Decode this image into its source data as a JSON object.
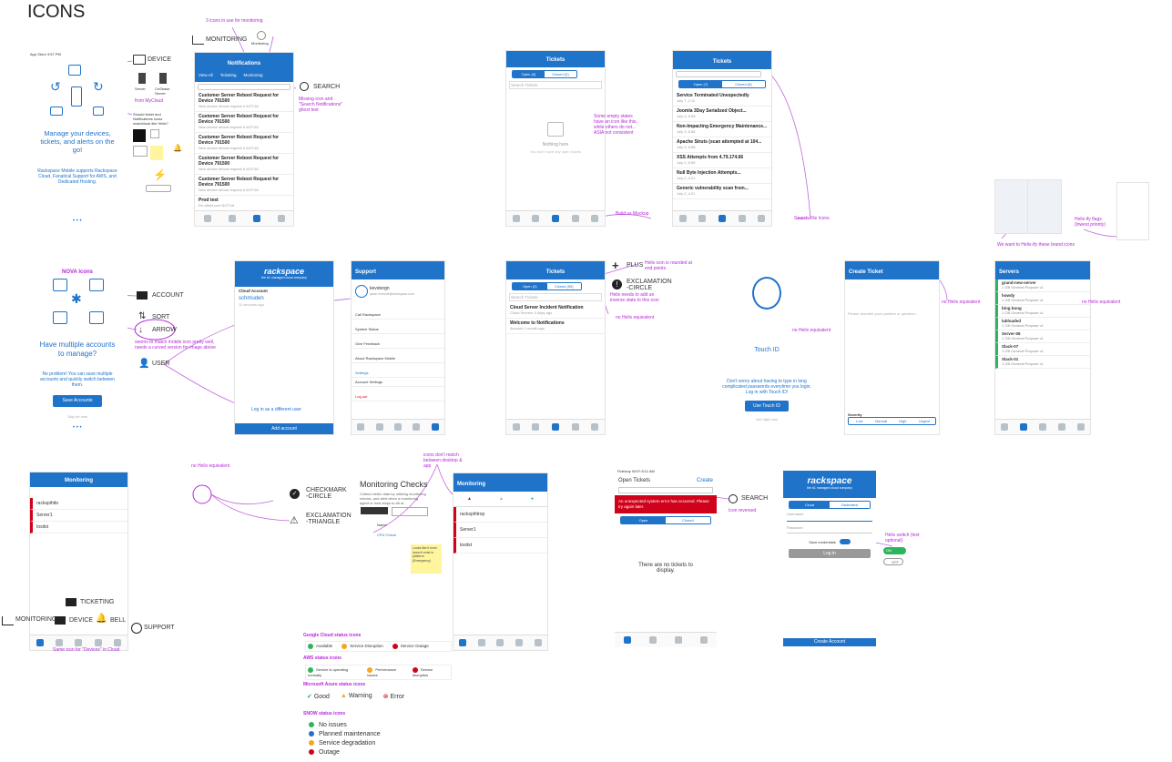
{
  "page": {
    "title": "ICONS"
  },
  "colors": {
    "accent": "#1f73c9",
    "annotation": "#b529d6",
    "green": "#2db55d",
    "red": "#d0021b"
  },
  "onboarding": {
    "status": "App Store",
    "time": "3:57 PM",
    "headline": "Manage your devices, tickets, and alerts on the go!",
    "sub": "Rackspace Mobile supports Rackspace Cloud, Fanatical Support for AWS, and Dedicated Hosting.",
    "device_label": "DEVICE",
    "server_label": "Server",
    "cnsbr_label": "CnSbase Server",
    "from_mycloud": "from MyCloud",
    "question": "Should ticket and Notifications icons match/look like Helix?"
  },
  "notifications": {
    "count_note": "3 icons in use for monitoring",
    "monitoring_label": "MONITORING",
    "monitoring_small": "Monitoring",
    "title": "Notifications",
    "tabs": [
      "View All",
      "Ticketing",
      "Monitoring"
    ],
    "items": [
      {
        "title": "Customer Server Reboot Request for Device 791500",
        "sub": "New device reboot request #",
        "date": "6/27/18"
      },
      {
        "title": "Customer Server Reboot Request for Device 791500",
        "sub": "New device reboot request #",
        "date": "6/27/18"
      },
      {
        "title": "Customer Server Reboot Request for Device 791500",
        "sub": "New device reboot request #",
        "date": "6/27/18"
      },
      {
        "title": "Customer Server Reboot Request for Device 791500",
        "sub": "New device reboot request #",
        "date": "6/27/18"
      },
      {
        "title": "Customer Server Reboot Request for Device 791500",
        "sub": "New device reboot request #",
        "date": "6/27/18"
      },
      {
        "title": "Prod test",
        "sub": "Ro offset.com",
        "date": "6/27/18"
      }
    ],
    "search_label": "SEARCH",
    "search_note": "Missing icon and \"Search Notifications\" ghost text"
  },
  "tickets_empty": {
    "title": "Tickets",
    "tabs": [
      "Open (0)",
      "Closed (0)"
    ],
    "search": "Search Tickets",
    "empty_title": "Nothing here",
    "empty_sub": "You don't have any open tickets",
    "note": "Some empty states have an icon like this, while others do not... ASIA not consistent",
    "build_note": "Build vs Mockup"
  },
  "tickets_list": {
    "title": "Tickets",
    "tabs": [
      "Open (7)",
      "Closed (8)"
    ],
    "items": [
      {
        "title": "Service Terminated Unexpectedly",
        "date": "July 7, 2:11"
      },
      {
        "title": "Joomla 3Day Serialized Object...",
        "date": "July 3, 6:58"
      },
      {
        "title": "Non-Impacting Emergency Maintenance...",
        "date": "July 3, 6:58"
      },
      {
        "title": "Apache Struts (scan attempted at 104...",
        "date": "July 3, 6:58"
      },
      {
        "title": "XSS Attempts from 4.79.174.66",
        "date": "July 2, 6:59"
      },
      {
        "title": "Null Byte Injection Attempts...",
        "date": "July 2, 4:21"
      },
      {
        "title": "Generic vulnerability scan from...",
        "date": "July 2, 4:21"
      }
    ],
    "search_note": "Search File Icons"
  },
  "helix": {
    "want_note": "We want to Helix-ify these brand icons",
    "flags_note": "Helix-ify flags (lowest priority)"
  },
  "nova": {
    "title": "NOVA Icons",
    "headline": "Have multiple accounts to manage?",
    "sub": "No problem! You can save multiple accounts and quickly switch between them.",
    "button": "Save Accounts",
    "skip": "Skip for now",
    "account_label": "ACCOUNT",
    "sort_label": "SORT",
    "arrow_label": "ARROW",
    "user_label": "USER",
    "arrow_note": "seems to match mobile icon pretty well, needs a curved version for image above"
  },
  "login": {
    "brand": "rackspace",
    "tagline": "the #1 managed cloud company",
    "section": "Cloud Account",
    "user": "schmuden",
    "seen": "11 seconds ago",
    "different": "Log in as a different user",
    "add": "Add account"
  },
  "support": {
    "title": "Support",
    "user": "kevstergn",
    "email": "jason.mcbride@rackspace.com",
    "menu": [
      "Call Rackspace",
      "System Status",
      "Give Feedback",
      "About Rackspace Mobile",
      "Settings",
      "Account Settings",
      "Log out"
    ]
  },
  "tickets2": {
    "title": "Tickets",
    "tabs": [
      "Open (2)",
      "Closed (55)"
    ],
    "search": "Search Tickets",
    "items": [
      {
        "title": "Cloud Server Incident Notification",
        "sub": "Cloud Servers",
        "date": "3 days ago"
      },
      {
        "title": "Welcome to Notifications",
        "sub": "Account",
        "date": "1 month ago"
      }
    ],
    "plus_label": "PLUS",
    "plus_note": "Helix icon is rounded at end points",
    "excl_label": "EXCLAMATION -CIRCLE",
    "excl_note": "Helix needs to add an inverse state to this icon",
    "no_helix": "no Helix equivalent"
  },
  "touchid": {
    "title": "Touch ID",
    "sub": "Don't worry about having to type in long complicated passwords everytime you login. Log in with Touch ID!",
    "button": "Use Touch ID",
    "skip": "Not right now",
    "no_helix": "no Helix equivalent"
  },
  "create_ticket": {
    "title": "Create Ticket",
    "placeholder": "Please describe your problem or question...",
    "severity": "Severity",
    "levels": [
      "Low",
      "Normal",
      "High",
      "Urgent"
    ],
    "no_helix": "no Helix equivalent"
  },
  "servers": {
    "title": "Servers",
    "items": [
      {
        "name": "grand-new-server",
        "sub": "1 GB General Purpose v1"
      },
      {
        "name": "howdy",
        "sub": "1 GB General Purpose v1"
      },
      {
        "name": "bing bong",
        "sub": "1 GB General Purpose v1"
      },
      {
        "name": "labloaded",
        "sub": "1 GB General Purpose v1"
      },
      {
        "name": "Server-06",
        "sub": "1 GB General Purpose v1"
      },
      {
        "name": "Slack-07",
        "sub": "1 GB General Purpose v1"
      },
      {
        "name": "Slack-01",
        "sub": "1 GB General Purpose v1"
      }
    ],
    "no_helix": "no Helix equivalent"
  },
  "monitoring": {
    "title": "Monitoring",
    "items": [
      "rackspihtto",
      "Server1",
      "tositst"
    ],
    "ticketing_label": "TICKETING",
    "monitoring_label": "MONITORING",
    "device_label": "DEVICE",
    "bell_label": "BELL",
    "support_label": "SUPPORT",
    "bottom_note": "Same icon for \"Devices\" in Cloud"
  },
  "checks": {
    "no_helix": "no Helix equivalent",
    "check_label": "CHECKMARK -CIRCLE",
    "tri_label": "EXCLAMATION -TRIANGLE",
    "title": "Monitoring Checks",
    "sub": "Collect metric data by utilizing monitoring checks, and alert when a monitoring agent or host stops to all of...",
    "name_col": "Name",
    "item": "CPU Check",
    "note": "icons don't match between desktop & app",
    "sticky": "Looks like it even doesn't exist in platform (Emergency)"
  },
  "monitoring2": {
    "title": "Monitoring",
    "tabs": [
      "",
      "",
      ""
    ],
    "items": [
      "rackspihtrop",
      "Server1",
      "tositst"
    ]
  },
  "status": {
    "google_title": "Google Cloud status icons",
    "google": [
      "Available",
      "Service Disruption",
      "Service Outage"
    ],
    "aws_title": "AWS status icons",
    "aws": [
      "Service is operating normally",
      "Performance issues",
      "Service disruption"
    ],
    "azure_title": "Microsoft Azure status icons",
    "azure": [
      "Good",
      "Warning",
      "Error"
    ],
    "snow_title": "SNOW status icons",
    "snow": [
      "No issues",
      "Planned maintenance",
      "Service degradation",
      "Outage"
    ]
  },
  "open_tickets": {
    "carrier": "Fideicoy Wi-Fi",
    "time": "8:11 AM",
    "title": "Open Tickets",
    "create": "Create",
    "error": "An unexpected system error has occurred. Please try again later.",
    "tabs": [
      "Open",
      "Closed"
    ],
    "empty": "There are no tickets to display.",
    "search_label": "SEARCH",
    "reversed_note": "Icon reversed"
  },
  "login2": {
    "brand": "rackspace",
    "tagline": "the #1 managed cloud company",
    "tabs": [
      "Cloud",
      "Dedicated"
    ],
    "user_label": "Username",
    "pass_label": "Password",
    "save": "Save credentials",
    "button": "Log in",
    "bottom_button": "Create Account",
    "switch_note": "Helix switch (text optional)",
    "on": "ON",
    "off": "OFF"
  }
}
